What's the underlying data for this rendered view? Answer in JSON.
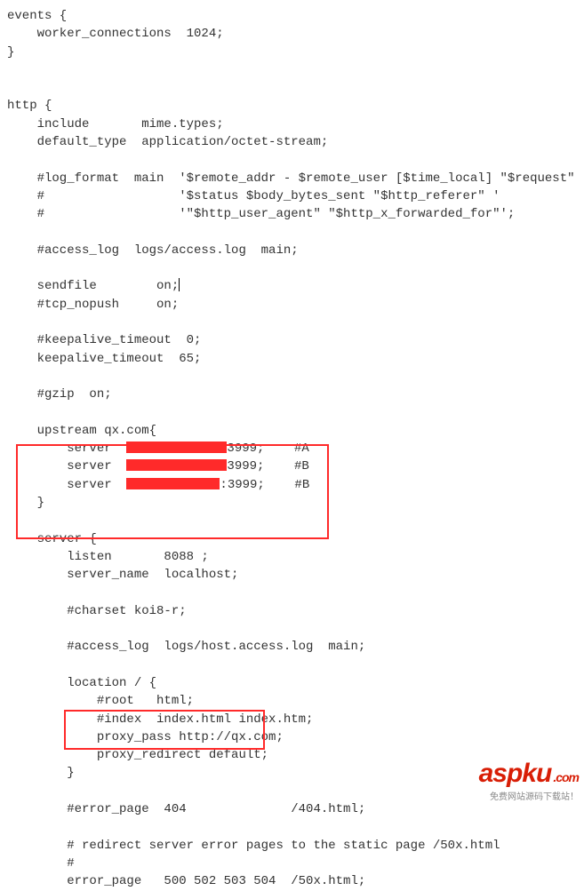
{
  "code": {
    "l1": "events {",
    "l2": "    worker_connections  1024;",
    "l3": "}",
    "l4": "",
    "l5": "",
    "l6": "http {",
    "l7": "    include       mime.types;",
    "l8": "    default_type  application/octet-stream;",
    "l9": "",
    "l10": "    #log_format  main  '$remote_addr - $remote_user [$time_local] \"$request\" '",
    "l11": "    #                  '$status $body_bytes_sent \"$http_referer\" '",
    "l12": "    #                  '\"$http_user_agent\" \"$http_x_forwarded_for\"';",
    "l13": "",
    "l14": "    #access_log  logs/access.log  main;",
    "l15": "",
    "l16": "    sendfile        on;",
    "l17": "    #tcp_nopush     on;",
    "l18": "",
    "l19": "    #keepalive_timeout  0;",
    "l20": "    keepalive_timeout  65;",
    "l21": "",
    "l22": "    #gzip  on;",
    "l23": "",
    "l24": "    upstream qx.com{",
    "l25a": "        server  ",
    "l25b": "3999;    #A",
    "l26a": "        server  ",
    "l26b": "3999;    #B",
    "l27a": "        server  ",
    "l27b": ":3999;    #B",
    "l28": "    }",
    "l29": "",
    "l30": "    server {",
    "l31": "        listen       8088 ;",
    "l32": "        server_name  localhost;",
    "l33": "",
    "l34": "        #charset koi8-r;",
    "l35": "",
    "l36": "        #access_log  logs/host.access.log  main;",
    "l37": "",
    "l38": "        location / {",
    "l39": "            #root   html;",
    "l40": "            #index  index.html index.htm;",
    "l41": "            proxy_pass http://qx.com;",
    "l42": "            proxy_redirect default;",
    "l43": "        }",
    "l44": "",
    "l45": "        #error_page  404              /404.html;",
    "l46": "",
    "l47": "        # redirect server error pages to the static page /50x.html",
    "l48": "        #",
    "l49": "        error_page   500 502 503 504  /50x.html;"
  },
  "watermark": {
    "main": "aspku",
    "dotcom": ".com",
    "sub": "免费网站源码下载站！"
  }
}
